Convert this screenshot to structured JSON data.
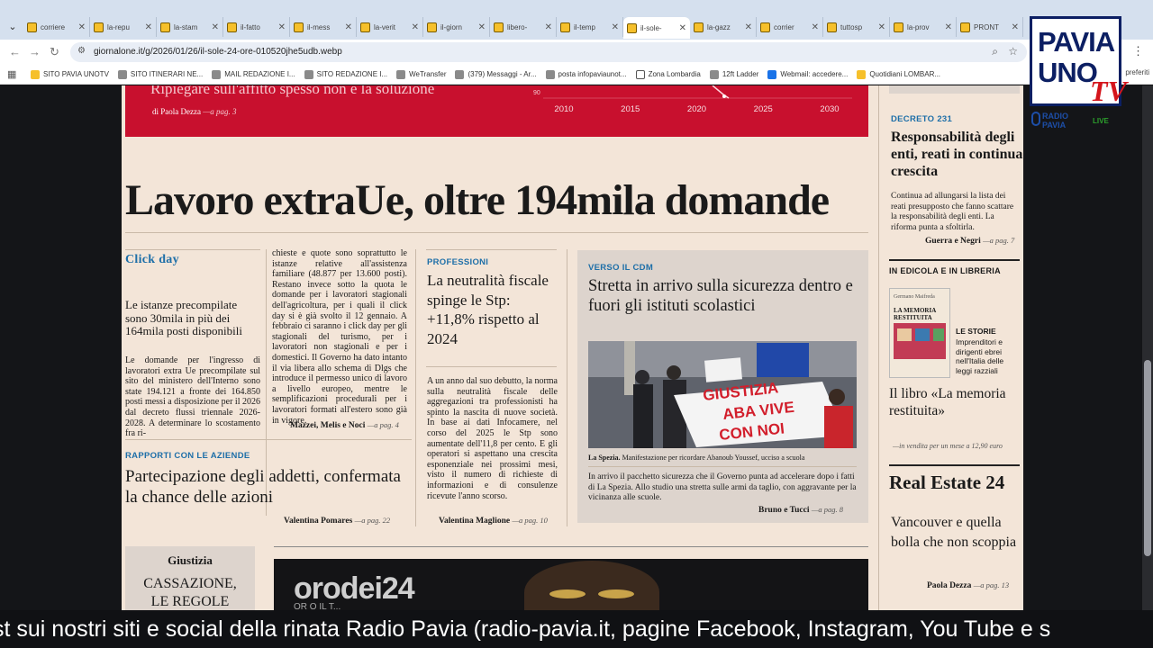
{
  "browser": {
    "tabs": [
      {
        "label": "corriere"
      },
      {
        "label": "la-repu"
      },
      {
        "label": "la-stam"
      },
      {
        "label": "il-fatto"
      },
      {
        "label": "il-mess"
      },
      {
        "label": "la-verit"
      },
      {
        "label": "il-giorn"
      },
      {
        "label": "libero-"
      },
      {
        "label": "il-temp"
      },
      {
        "label": "il-sole-",
        "active": true
      },
      {
        "label": "la-gazz"
      },
      {
        "label": "corrier"
      },
      {
        "label": "tuttosp"
      },
      {
        "label": "la-prov"
      },
      {
        "label": "PRONT"
      }
    ],
    "url": "giornalone.it/g/2026/01/26/il-sole-24-ore-010520jhe5udb.webp",
    "bookmarks": [
      "SITO PAVIA UNOTV",
      "SITO ITINERARI NE...",
      "MAIL REDAZIONE I...",
      "SITO REDAZIONE I...",
      "WeTransfer",
      "(379) Messaggi - Ar...",
      "posta infopaviaunot...",
      "Zona Lombardia",
      "12ft Ladder",
      "Webmail: accedere...",
      "Quotidiani LOMBAR..."
    ],
    "bookmarks_more": "preferiti"
  },
  "newspaper": {
    "banner": {
      "text": "Ripiegare sull'affitto spesso non è la soluzione",
      "author": "di Paola Dezza",
      "page": "—a pag. 3"
    },
    "chart": {
      "type": "line",
      "x_ticks": [
        "2010",
        "2015",
        "2020",
        "2025",
        "2030"
      ],
      "y_tick": "90"
    },
    "headline": "Lavoro extraUe, oltre 194mila domande",
    "click_day": {
      "kicker": "Click day",
      "subhead": "Le istanze precompilate sono 30mila in più dei 164mila posti disponibili",
      "body1": "Le domande per l'ingresso di lavoratori extra Ue precompilate sul sito del ministero dell'Interno sono state 194.121 a fronte dei 164.850 posti messi a disposizione per il 2026 dal decreto flussi triennale 2026-2028. A determinare lo scostamento fra ri-",
      "body2": "chieste e quote sono soprattutto le istanze relative all'assistenza familiare (48.877 per 13.600 posti). Restano invece sotto la quota le domande per i lavoratori stagionali dell'agricoltura, per i quali il click day si è già svolto il 12 gennaio. A febbraio ci saranno i click day per gli stagionali del turismo, per i lavoratori non stagionali e per i domestici. Il Governo ha dato intanto il via libera allo schema di Dlgs che introduce il permesso unico di lavoro a livello europeo, mentre le semplificazioni procedurali per i lavoratori formati all'estero sono già in vigore.",
      "byline": "Mazzei, Melis e Noci",
      "page": "—a pag. 4"
    },
    "rapporti": {
      "kicker": "RAPPORTI CON LE AZIENDE",
      "title": "Partecipazione degli addetti, confermata la chance delle azioni",
      "byline": "Valentina Pomares",
      "page": "—a pag. 22"
    },
    "professioni": {
      "kicker": "PROFESSIONI",
      "title": "La neutralità fiscale spinge le Stp: +11,8% rispetto al 2024",
      "body": "A un anno dal suo debutto, la norma sulla neutralità fiscale delle aggregazioni tra professionisti ha spinto la nascita di nuove società. In base ai dati Infocamere, nel corso del 2025 le Stp sono aumentate dell'11,8 per cento. E gli operatori si aspettano una crescita esponenziale nei prossimi mesi, visto il numero di richieste di informazioni e di consulenze ricevute l'anno scorso.",
      "byline": "Valentina Maglione",
      "page": "—a pag. 10"
    },
    "cdm": {
      "kicker": "VERSO IL CDM",
      "title": "Stretta in arrivo sulla sicurezza dentro e fuori gli istituti scolastici",
      "caption_bold": "La Spezia.",
      "caption": "Manifestazione per ricordare Abanoub Youssef, ucciso a scuola",
      "banner_lines": [
        "GIUSTIZIA",
        "ABA VIVE",
        "CON NOI"
      ],
      "body": "In arrivo il pacchetto sicurezza che il Governo punta ad accelerare dopo i fatti di La Spezia. Allo studio una stretta sulle armi da taglio, con aggravante per la vicinanza alle scuole.",
      "byline": "Bruno e Tucci",
      "page": "—a pag. 8"
    },
    "right": {
      "kicker1": "DECRETO 231",
      "title1": "Responsabilità degli enti, reati in continua crescita",
      "body1": "Continua ad allungarsi la lista dei reati presupposto che fanno scattare la responsabilità degli enti. La riforma punta a sfoltirla.",
      "byline1": "Guerra e Negri",
      "page1": "—a pag. 7",
      "edicola": "IN EDICOLA E IN LIBRERIA",
      "book_author": "Germano Maifreda",
      "book_cover_title": "LA MEMORIA RESTITUITA",
      "storie_title": "LE STORIE",
      "storie_text": "Imprenditori e dirigenti ebrei nell'Italia delle leggi razziali",
      "libro_title": "Il libro «La memoria restituita»",
      "libro_sub": "—in vendita per un mese a 12,90 euro",
      "re_title": "Real Estate 24",
      "re_sub": "Vancouver e quella bolla che non scoppia",
      "re_byline": "Paola Dezza",
      "re_page": "—a pag. 13"
    },
    "giustizia": {
      "kicker": "Giustizia",
      "title": "CASSAZIONE, LE REGOLE"
    },
    "ad": {
      "brand": "orodei24",
      "sub": "OR O IL T..."
    }
  },
  "overlay": {
    "logo_line1": "PAVIA",
    "logo_line2": "UNO",
    "logo_tv": "TV",
    "radio_line1": "RADIO",
    "radio_line2": "PAVIA",
    "live": "LIVE",
    "ticker": "st sui nostri siti e social della rinata Radio Pavia (radio-pavia.it, pagine Facebook, Instagram, You Tube e s"
  },
  "colors": {
    "banner_red": "#c8102e",
    "kicker_blue": "#1e6fa8",
    "paper": "#f3e5d8",
    "logo_navy": "#0c1f63",
    "logo_red": "#d4151c"
  }
}
